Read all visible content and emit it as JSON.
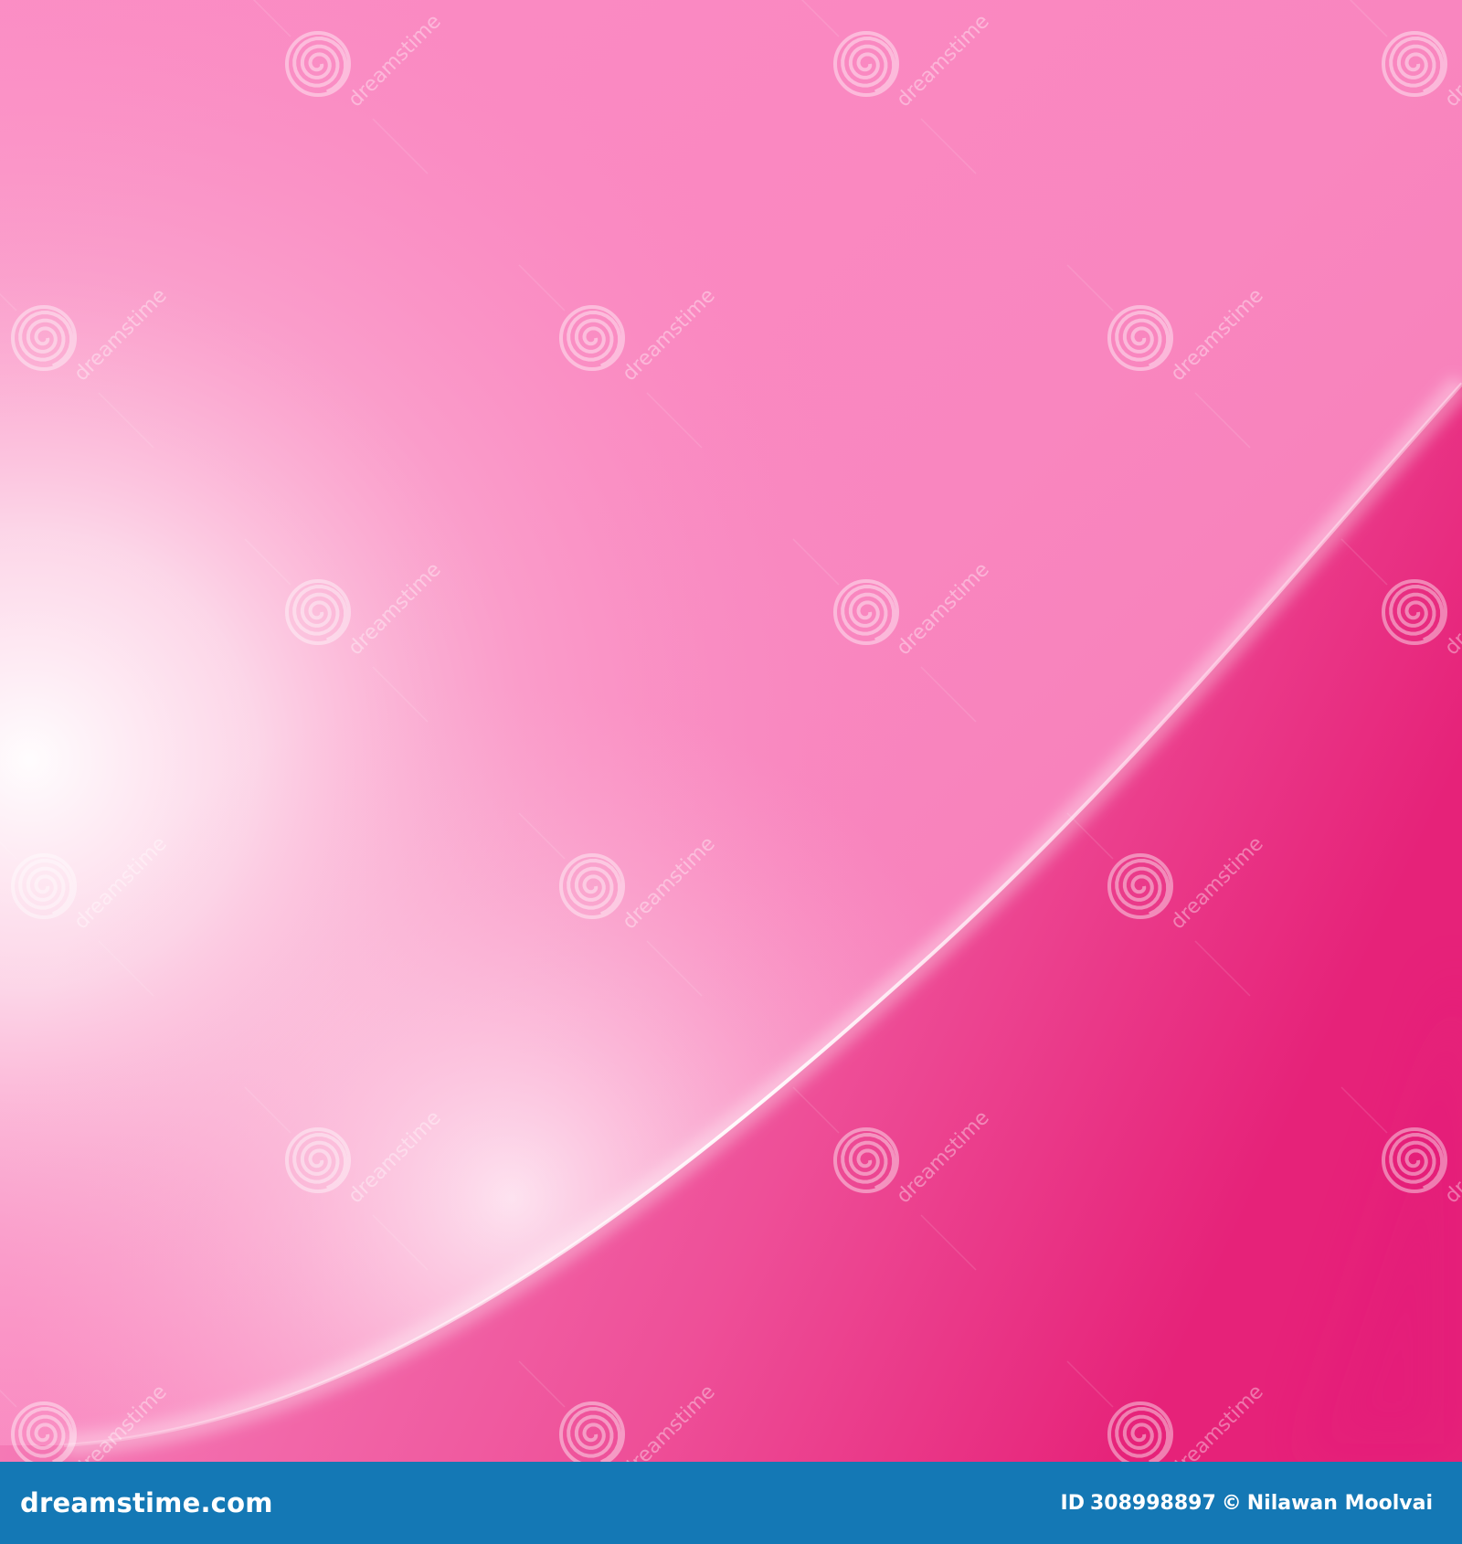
{
  "image": {
    "description_colors": {
      "light_pink": "#fbd3e6",
      "mid_pink": "#f87fb9",
      "deep_pink": "#e8207c",
      "highlight": "#ffffff"
    }
  },
  "watermark": {
    "brand_text": "dreamstime",
    "icon": "spiral-logo-icon"
  },
  "footer": {
    "background_color": "#1478b5",
    "brand": "dreamstime.com",
    "id_label": "ID",
    "id_value": "308998897",
    "copyright_symbol": "©",
    "author": "Nilawan Moolvai"
  }
}
